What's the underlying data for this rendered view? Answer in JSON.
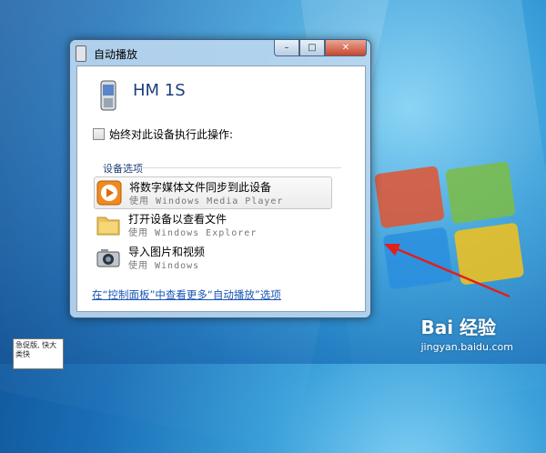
{
  "window": {
    "title": "自动播放",
    "buttons": {
      "minimize": "–",
      "maximize": "□",
      "close": "✕"
    }
  },
  "device": {
    "name": "HM 1S",
    "icon": "phone-icon"
  },
  "always_label": "始终对此设备执行此操作:",
  "section_label": "设备选项",
  "options": [
    {
      "main": "将数字媒体文件同步到此设备",
      "sub": "使用 Windows Media Player",
      "icon": "media-player-icon"
    },
    {
      "main": "打开设备以查看文件",
      "sub": "使用 Windows Explorer",
      "icon": "folder-icon"
    },
    {
      "main": "导入图片和视频",
      "sub": "使用 Windows",
      "icon": "camera-icon"
    }
  ],
  "control_panel_link": "在“控制面板”中查看更多“自动播放”选项",
  "desktop_icon_text": "急促版,  快大类快",
  "watermark": {
    "brand": "Bai 经验",
    "url": "jingyan.baidu.com"
  },
  "colors": {
    "title_text": "#1e3f7a",
    "link": "#1a55b5",
    "arrow": "#e0201b"
  }
}
